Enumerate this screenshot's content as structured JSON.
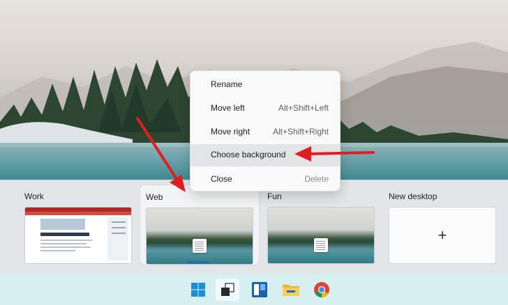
{
  "context_menu": {
    "items": [
      {
        "label": "Rename",
        "shortcut": ""
      },
      {
        "label": "Move left",
        "shortcut": "Alt+Shift+Left"
      },
      {
        "label": "Move right",
        "shortcut": "Alt+Shift+Right"
      },
      {
        "label": "Choose background",
        "shortcut": ""
      },
      {
        "label": "Close",
        "shortcut": "Delete"
      }
    ],
    "highlighted": "Choose background"
  },
  "desktops": [
    {
      "name": "Work"
    },
    {
      "name": "Web",
      "selected": true
    },
    {
      "name": "Fun"
    }
  ],
  "new_desktop": {
    "label": "New desktop",
    "icon": "+"
  },
  "taskbar": {
    "icons": [
      "windows-start-icon",
      "task-view-icon",
      "widgets-icon",
      "file-explorer-icon",
      "chrome-icon"
    ]
  },
  "colors": {
    "annotation_arrow": "#e01e1e",
    "menu_highlight": "#e3e4e5",
    "active_indicator": "#1f6ab0",
    "taskbar": "#d7eff0"
  }
}
